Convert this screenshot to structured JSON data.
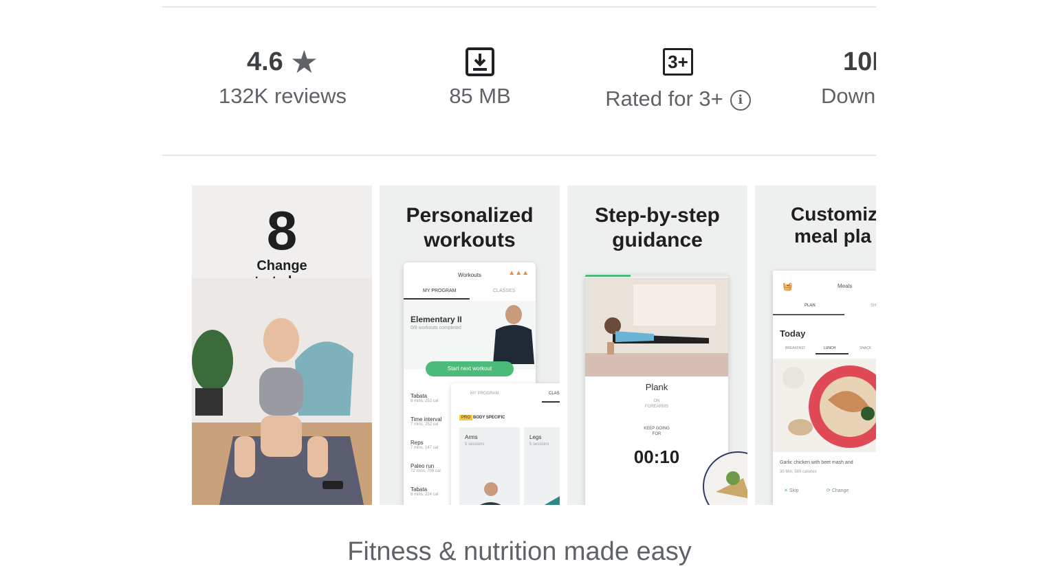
{
  "stats": {
    "rating": {
      "value": "4.6",
      "label": "132K reviews",
      "icon": "star-icon"
    },
    "size": {
      "value": "85 MB",
      "icon": "download-icon"
    },
    "content_rating": {
      "badge": "3+",
      "label": "Rated for 3+",
      "icon": "info-icon"
    },
    "downloads": {
      "value": "10I",
      "label": "Down"
    }
  },
  "screenshots": [
    {
      "logo_text": "8",
      "title": "Change\nstarts here"
    },
    {
      "title_line1": "Personalized",
      "title_line2": "workouts",
      "phone_header": "Workouts",
      "tab_program": "MY PROGRAM",
      "tab_classes": "CLASSES",
      "program_name": "Elementary II",
      "program_sub": "0/8 workouts completed",
      "cta": "Start next workout",
      "list": [
        {
          "name": "Tabata",
          "meta": "8 mins, 252 cal"
        },
        {
          "name": "Time interval",
          "meta": "7 mins, 252 cal"
        },
        {
          "name": "Reps",
          "meta": "7 mins, 147 cal"
        },
        {
          "name": "Paleo run",
          "meta": "72 mins, 708 cal"
        },
        {
          "name": "Tabata",
          "meta": "8 mins, 224 cal"
        }
      ],
      "overlay_tab1": "MY PROGRAM",
      "overlay_tab2": "CLAS",
      "overlay_badge": "PRO",
      "overlay_section": "BODY SPECIFIC",
      "card1_title": "Arms",
      "card1_sub": "5 sessions",
      "card2_title": "Legs",
      "card2_sub": "5 sessions"
    },
    {
      "title_line1": "Step-by-step",
      "title_line2": "guidance",
      "exercise": "Plank",
      "sub": "ON\nFOREARMS",
      "keep_going": "KEEP GOING\nFOR",
      "timer": "00:10"
    },
    {
      "title_line1": "Customiz",
      "title_line2": "meal pla",
      "phone_header": "Meals",
      "tab_plan": "PLAN",
      "tab_other": "SH",
      "today": "Today",
      "meal_tabs": [
        "BREAKFAST",
        "LUNCH",
        "SNACK"
      ],
      "dish": "Garlic chicken with beet mash and",
      "dish_meta": "30 Min, 589 calories",
      "skip": "Skip",
      "change": "Change"
    }
  ],
  "caption": "Fitness & nutrition made easy"
}
